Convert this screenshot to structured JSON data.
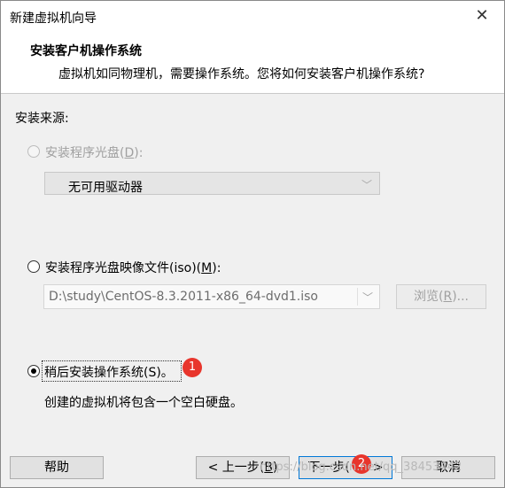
{
  "window": {
    "title": "新建虚拟机向导"
  },
  "header": {
    "title": "安装客户机操作系统",
    "subtitle": "虚拟机如同物理机，需要操作系统。您将如何安装客户机操作系统?"
  },
  "install_source_label": "安装来源:",
  "options": {
    "disc": {
      "label_prefix": "安装程序光盘(",
      "accel": "D",
      "label_suffix": "):",
      "checked": false,
      "enabled": false
    },
    "disc_drive": {
      "value": "无可用驱动器"
    },
    "iso": {
      "label_prefix": "安装程序光盘映像文件(iso)(",
      "accel": "M",
      "label_suffix": "):",
      "checked": false,
      "enabled": true
    },
    "iso_path": {
      "value": "D:\\study\\CentOS-8.3.2011-x86_64-dvd1.iso"
    },
    "browse": {
      "label_prefix": "浏览(",
      "accel": "R",
      "label_suffix": ")..."
    },
    "later": {
      "label": "稍后安装操作系统(S)。",
      "checked": true,
      "enabled": true
    },
    "later_desc": "创建的虚拟机将包含一个空白硬盘。"
  },
  "annotations": {
    "badge1": "1",
    "badge2": "2"
  },
  "footer": {
    "help": "帮助",
    "back_prefix": "< 上一步(",
    "back_accel": "B",
    "back_suffix": ")",
    "next_prefix": "下一步(",
    "next_suffix": ">",
    "cancel": "取消"
  },
  "watermark": "https://blog.csdn.net/qq_38453442",
  "colors": {
    "badge": "#e8352c",
    "focus_border": "#0078d7"
  }
}
